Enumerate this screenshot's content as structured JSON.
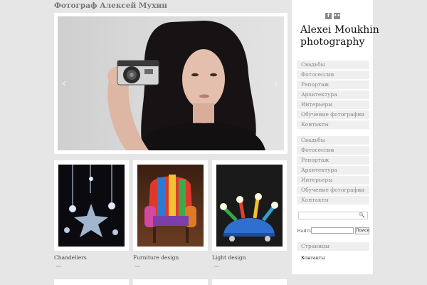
{
  "site": {
    "title": "Фотограф Алексей Мухин"
  },
  "brand": {
    "line1": "Alexei Moukhin",
    "line2": "photography"
  },
  "social": [
    {
      "icon": "facebook-icon",
      "glyph": "f"
    },
    {
      "icon": "flickr-icon",
      "glyph": "••"
    }
  ],
  "slider": {
    "prev_glyph": "‹",
    "next_glyph": "›"
  },
  "thumbs": [
    {
      "caption": "Chandeliers"
    },
    {
      "caption": "Furniture design"
    },
    {
      "caption": "Light design"
    }
  ],
  "menu1": [
    "Свадьбы",
    "Фотосессии",
    "Репортаж",
    "Архитектура",
    "Интерьеры",
    "Обучение фотографии",
    "Контакты"
  ],
  "menu2": [
    "Свадьбы",
    "Фотосессии",
    "Репортаж",
    "Архитектура",
    "Интерьеры",
    "Обучение фотографии",
    "Контакты"
  ],
  "search": {
    "mag": "🔍",
    "label": "Найти:",
    "button": "Поиск"
  },
  "pages": {
    "heading": "Страницы",
    "items": [
      "Контакты"
    ]
  },
  "colors": {
    "sidebar_bg": "#ffffff",
    "menu_bg": "#efefef",
    "page_bg": "#e6e6e6"
  }
}
